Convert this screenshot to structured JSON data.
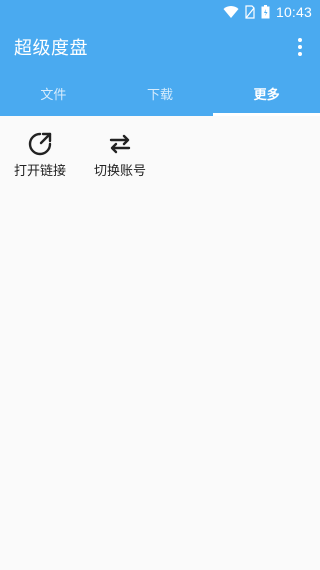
{
  "status_bar": {
    "time": "10:43"
  },
  "app_bar": {
    "title": "超级度盘"
  },
  "tabs": [
    {
      "label": "文件",
      "active": false
    },
    {
      "label": "下载",
      "active": false
    },
    {
      "label": "更多",
      "active": true
    }
  ],
  "actions": [
    {
      "label": "打开链接",
      "icon": "open-link-icon"
    },
    {
      "label": "切换账号",
      "icon": "switch-account-icon"
    }
  ],
  "colors": {
    "primary": "#4aaaf0",
    "background": "#fafafa",
    "text": "#222222"
  }
}
